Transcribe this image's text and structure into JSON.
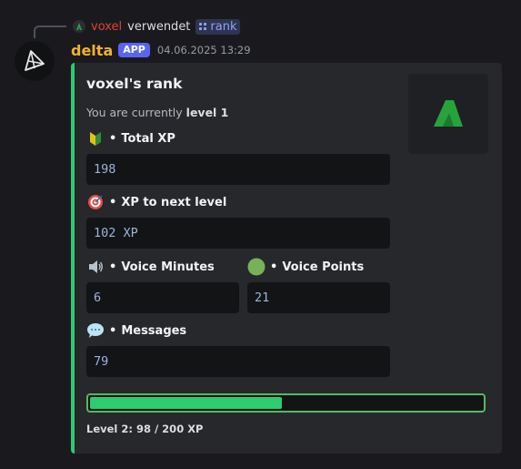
{
  "reply": {
    "user": "voxel",
    "verb": "verwendet",
    "command": "rank"
  },
  "message": {
    "bot_name": "delta",
    "badge": "APP",
    "timestamp": "04.06.2025 13:29"
  },
  "embed": {
    "accent_color": "#2ecc71",
    "title": "voxel's rank",
    "desc_prefix": "You are currently ",
    "desc_level": "level 1",
    "fields": {
      "total_xp": {
        "icon": "beginner-badge-icon",
        "label": "Total XP",
        "value": "198"
      },
      "xp_next": {
        "icon": "target-icon",
        "label": "XP to next level",
        "value": "102 XP"
      },
      "voice_minutes": {
        "icon": "speaker-icon",
        "label": "Voice Minutes",
        "value": "6"
      },
      "voice_points": {
        "icon": "green-circle-icon",
        "label": "Voice Points",
        "value": "21"
      },
      "messages": {
        "icon": "speech-bubble-icon",
        "label": "Messages",
        "value": "79"
      }
    },
    "separator": "•",
    "progress": {
      "value": 0.49,
      "label": "Level 2: 98 / 200 XP"
    }
  }
}
